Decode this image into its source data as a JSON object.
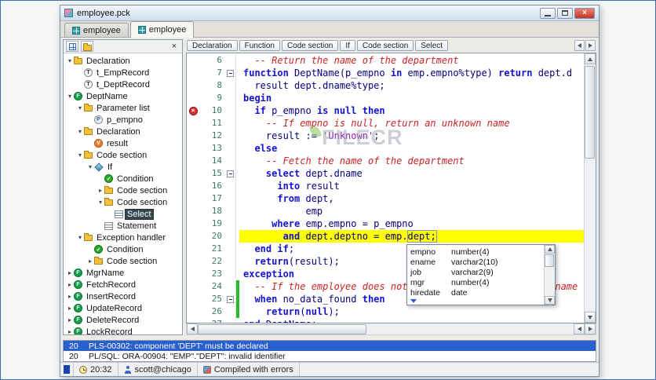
{
  "window": {
    "title": "employee.pck"
  },
  "tabs": [
    {
      "label": "employee",
      "active": false
    },
    {
      "label": "employee",
      "active": true
    }
  ],
  "tree": {
    "items": [
      {
        "label": "Declaration",
        "depth": 0,
        "icon": "folder",
        "expand": "open"
      },
      {
        "label": "t_EmpRecord",
        "depth": 1,
        "icon": "type"
      },
      {
        "label": "t_DeptRecord",
        "depth": 1,
        "icon": "type"
      },
      {
        "label": "DeptName",
        "depth": 0,
        "icon": "function",
        "expand": "open"
      },
      {
        "label": "Parameter list",
        "depth": 1,
        "icon": "folder",
        "expand": "open"
      },
      {
        "label": "p_empno",
        "depth": 2,
        "icon": "param"
      },
      {
        "label": "Declaration",
        "depth": 1,
        "icon": "folder",
        "expand": "open"
      },
      {
        "label": "result",
        "depth": 2,
        "icon": "variable"
      },
      {
        "label": "Code section",
        "depth": 1,
        "icon": "folder",
        "expand": "open"
      },
      {
        "label": "If",
        "depth": 2,
        "icon": "if",
        "expand": "open"
      },
      {
        "label": "Condition",
        "depth": 3,
        "icon": "condition"
      },
      {
        "label": "Code section",
        "depth": 3,
        "icon": "folder",
        "expand": "closed"
      },
      {
        "label": "Code section",
        "depth": 3,
        "icon": "folder",
        "expand": "open"
      },
      {
        "label": "Select",
        "depth": 4,
        "icon": "statement",
        "selected": true
      },
      {
        "label": "Statement",
        "depth": 3,
        "icon": "statement"
      },
      {
        "label": "Exception handler",
        "depth": 1,
        "icon": "folder",
        "expand": "open"
      },
      {
        "label": "Condition",
        "depth": 2,
        "icon": "condition"
      },
      {
        "label": "Code section",
        "depth": 2,
        "icon": "folder",
        "expand": "closed"
      },
      {
        "label": "MgrName",
        "depth": 0,
        "icon": "function",
        "expand": "closed"
      },
      {
        "label": "FetchRecord",
        "depth": 0,
        "icon": "function",
        "expand": "closed"
      },
      {
        "label": "InsertRecord",
        "depth": 0,
        "icon": "function",
        "expand": "closed"
      },
      {
        "label": "UpdateRecord",
        "depth": 0,
        "icon": "function",
        "expand": "closed"
      },
      {
        "label": "DeleteRecord",
        "depth": 0,
        "icon": "function",
        "expand": "closed"
      },
      {
        "label": "LockRecord",
        "depth": 0,
        "icon": "function",
        "expand": "closed"
      }
    ]
  },
  "breadcrumb": {
    "buttons": [
      "Declaration",
      "Function",
      "Code section",
      "If",
      "Code section",
      "Select"
    ]
  },
  "editor": {
    "lines": [
      {
        "no": 6,
        "seg": [
          [
            "c",
            "  -- Return the name of the department"
          ]
        ]
      },
      {
        "no": 7,
        "fold": true,
        "seg": [
          [
            "k",
            "function"
          ],
          [
            "i",
            " DeptName(p_empno "
          ],
          [
            "k",
            "in"
          ],
          [
            "i",
            " emp.empno%type) "
          ],
          [
            "k",
            "return"
          ],
          [
            "i",
            " dept.d"
          ]
        ]
      },
      {
        "no": 8,
        "seg": [
          [
            "i",
            "  result dept.dname%type;"
          ]
        ]
      },
      {
        "no": 9,
        "seg": [
          [
            "k",
            "begin"
          ]
        ]
      },
      {
        "no": 10,
        "error": true,
        "seg": [
          [
            "i",
            "  "
          ],
          [
            "k",
            "if"
          ],
          [
            "i",
            " p_empno "
          ],
          [
            "k",
            "is null then"
          ]
        ]
      },
      {
        "no": 11,
        "seg": [
          [
            "c",
            "    -- If empno is null, return an unknown name"
          ]
        ]
      },
      {
        "no": 12,
        "seg": [
          [
            "i",
            "    result := "
          ],
          [
            "s",
            "'Unknown'"
          ],
          [
            "i",
            ";"
          ]
        ]
      },
      {
        "no": 13,
        "seg": [
          [
            "i",
            "  "
          ],
          [
            "k",
            "else"
          ]
        ]
      },
      {
        "no": 14,
        "seg": [
          [
            "c",
            "    -- Fetch the name of the department"
          ]
        ]
      },
      {
        "no": 15,
        "fold": true,
        "seg": [
          [
            "i",
            "    "
          ],
          [
            "k",
            "select"
          ],
          [
            "i",
            " dept.dname"
          ]
        ]
      },
      {
        "no": 16,
        "seg": [
          [
            "i",
            "      "
          ],
          [
            "k",
            "into"
          ],
          [
            "i",
            " result"
          ]
        ]
      },
      {
        "no": 17,
        "seg": [
          [
            "i",
            "      "
          ],
          [
            "k",
            "from"
          ],
          [
            "i",
            " dept,"
          ]
        ]
      },
      {
        "no": 18,
        "seg": [
          [
            "i",
            "           emp"
          ]
        ]
      },
      {
        "no": 19,
        "seg": [
          [
            "i",
            "     "
          ],
          [
            "k",
            "where"
          ],
          [
            "i",
            " emp.empno = p_empno"
          ]
        ]
      },
      {
        "no": 20,
        "hl": true,
        "seg": [
          [
            "i",
            "       "
          ],
          [
            "k",
            "and"
          ],
          [
            "i",
            " dept.deptno = emp."
          ],
          [
            "b",
            "dept;"
          ]
        ]
      },
      {
        "no": 21,
        "seg": [
          [
            "i",
            "  "
          ],
          [
            "k",
            "end if"
          ],
          [
            "i",
            ";"
          ]
        ]
      },
      {
        "no": 22,
        "seg": [
          [
            "i",
            "  "
          ],
          [
            "k",
            "return"
          ],
          [
            "i",
            "(result);"
          ]
        ]
      },
      {
        "no": 23,
        "seg": [
          [
            "k",
            "exception"
          ]
        ]
      },
      {
        "no": 24,
        "changed": true,
        "seg": [
          [
            "c",
            "  -- If the employee does not exist, return an unknown name"
          ]
        ]
      },
      {
        "no": 25,
        "fold": true,
        "changed": true,
        "seg": [
          [
            "i",
            "  "
          ],
          [
            "k",
            "when"
          ],
          [
            "i",
            " no_data_found "
          ],
          [
            "k",
            "then"
          ]
        ]
      },
      {
        "no": 26,
        "changed": true,
        "seg": [
          [
            "i",
            "    "
          ],
          [
            "k",
            "return"
          ],
          [
            "i",
            "("
          ],
          [
            "k",
            "null"
          ],
          [
            "i",
            ");"
          ]
        ]
      },
      {
        "no": 27,
        "seg": [
          [
            "k",
            "end"
          ],
          [
            "i",
            " DeptName;"
          ]
        ]
      }
    ]
  },
  "completion": {
    "rows": [
      {
        "name": "empno",
        "type": "number(4)"
      },
      {
        "name": "ename",
        "type": "varchar2(10)"
      },
      {
        "name": "job",
        "type": "varchar2(9)"
      },
      {
        "name": "mgr",
        "type": "number(4)"
      },
      {
        "name": "hiredate",
        "type": "date"
      }
    ]
  },
  "errors": [
    {
      "line": "20",
      "message": "PLS-00302: component 'DEPT' must be declared",
      "selected": true
    },
    {
      "line": "20",
      "message": "PL/SQL: ORA-00904: \"EMP\".\"DEPT\": invalid identifier",
      "selected": false
    }
  ],
  "statusbar": {
    "time": "20:32",
    "connection": "scott@chicago",
    "status": "Compiled with errors"
  },
  "watermark": {
    "text": "FILECR"
  },
  "colors": {
    "highlight_line": "#ffff00",
    "keyword": "#1313cf",
    "comment": "#cc2222",
    "identifier": "#00007f",
    "string": "#8c1faf",
    "error_row_selected": "#2a5fd0",
    "tree_selected": "#37474f"
  }
}
